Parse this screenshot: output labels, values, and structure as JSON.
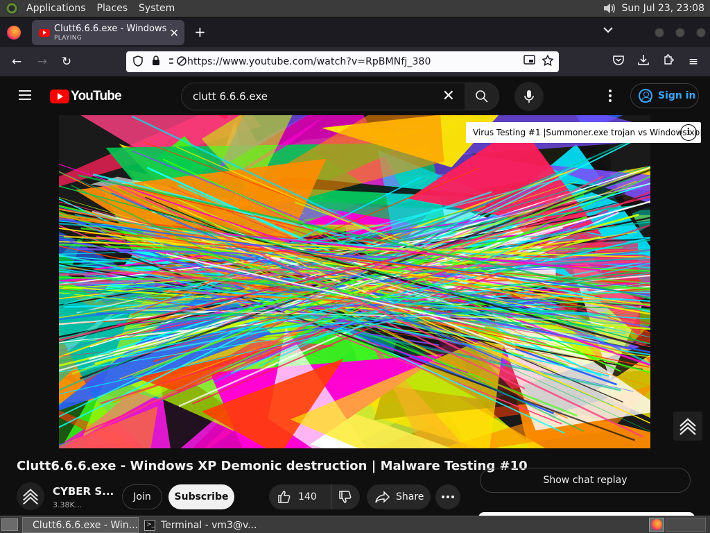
{
  "os_panel": {
    "menus": [
      "Applications",
      "Places",
      "System"
    ],
    "clock": "Sun Jul 23, 23:08"
  },
  "browser": {
    "tab": {
      "title": "Clutt6.6.6.exe - Windows XP",
      "subtitle": "PLAYING"
    },
    "url": "https://www.youtube.com/watch?v=RpBMNfj_380"
  },
  "youtube": {
    "logo_text": "YouTube",
    "search": {
      "query": "clutt 6.6.6.exe"
    },
    "signin_label": "Sign in",
    "card_teaser": "Virus Testing #1 |Summoner.exe trojan vs Windows xp|",
    "card_info": "i",
    "video": {
      "title": "Clutt6.6.6.exe - Windows XP Demonic destruction | Malware Testing #10"
    },
    "channel": {
      "name": "CYBER S...",
      "subscribers": "3.38K..."
    },
    "actions": {
      "join": "Join",
      "subscribe": "Subscribe",
      "likes": "140",
      "share": "Share"
    },
    "chat_replay": "Show chat replay"
  },
  "taskbar": {
    "tasks": [
      "Clutt6.6.6.exe - Win...",
      "Terminal - vm3@v..."
    ]
  },
  "colors": {
    "yt_red": "#ff0000",
    "link_blue": "#3ea6ff",
    "page_bg": "#0f0f0f"
  }
}
